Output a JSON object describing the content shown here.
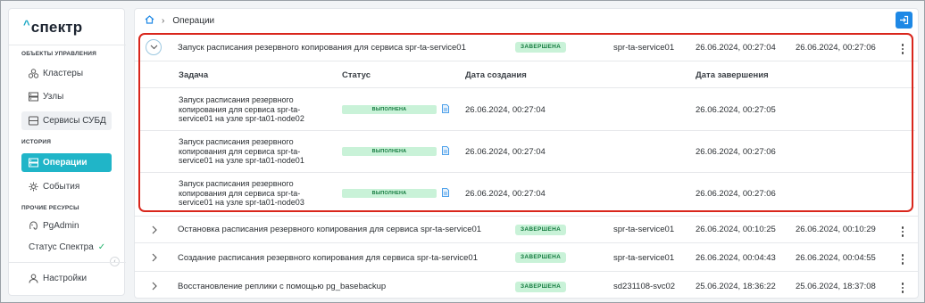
{
  "app": {
    "logo_text": "спектр",
    "accent_color": "#20b5c8",
    "highlight_color": "#d9261c"
  },
  "sidebar": {
    "section_management": "ОБЪЕКТЫ УПРАВЛЕНИЯ",
    "section_history": "ИСТОРИЯ",
    "section_other": "ПРОЧИЕ РЕСУРСЫ",
    "items": {
      "clusters": {
        "label": "Кластеры",
        "icon": "clusters-icon"
      },
      "nodes": {
        "label": "Узлы",
        "icon": "nodes-icon"
      },
      "dbms_services": {
        "label": "Сервисы СУБД",
        "icon": "database-icon"
      },
      "operations": {
        "label": "Операции",
        "icon": "operations-icon"
      },
      "events": {
        "label": "События",
        "icon": "events-icon"
      },
      "pgadmin": {
        "label": "PgAdmin",
        "icon": "pgadmin-icon"
      },
      "status": {
        "label": "Статус Спектра",
        "icon": "check-icon"
      },
      "settings": {
        "label": "Настройки",
        "icon": "user-icon"
      }
    }
  },
  "breadcrumb": {
    "home_icon": "home-icon",
    "current": "Операции"
  },
  "operations": [
    {
      "title": "Запуск расписания резервного копирования для сервиса spr-ta-service01",
      "status": "ЗАВЕРШЕНА",
      "service": "spr-ta-service01",
      "created": "26.06.2024, 00:27:04",
      "finished": "26.06.2024, 00:27:06"
    },
    {
      "title": "Остановка расписания резервного копирования для сервиса spr-ta-service01",
      "status": "ЗАВЕРШЕНА",
      "service": "spr-ta-service01",
      "created": "26.06.2024, 00:10:25",
      "finished": "26.06.2024, 00:10:29"
    },
    {
      "title": "Создание расписания резервного копирования для сервиса spr-ta-service01",
      "status": "ЗАВЕРШЕНА",
      "service": "spr-ta-service01",
      "created": "26.06.2024, 00:04:43",
      "finished": "26.06.2024, 00:04:55"
    },
    {
      "title": "Восстановление реплики с помощью pg_basebackup",
      "status": "ЗАВЕРШЕНА",
      "service": "sd231108-svc02",
      "created": "25.06.2024, 18:36:22",
      "finished": "25.06.2024, 18:37:08"
    }
  ],
  "subtable": {
    "headers": {
      "task": "Задача",
      "status": "Статус",
      "created": "Дата создания",
      "finished": "Дата завершения"
    },
    "tasks": [
      {
        "name": "Запуск расписания резервного копирования для сервиса spr-ta-service01 на узле spr-ta01-node02",
        "status": "ВЫПОЛНЕНА",
        "created": "26.06.2024, 00:27:04",
        "finished": "26.06.2024, 00:27:05"
      },
      {
        "name": "Запуск расписания резервного копирования для сервиса spr-ta-service01 на узле spr-ta01-node01",
        "status": "ВЫПОЛНЕНА",
        "created": "26.06.2024, 00:27:04",
        "finished": "26.06.2024, 00:27:06"
      },
      {
        "name": "Запуск расписания резервного копирования для сервиса spr-ta-service01 на узле spr-ta01-node03",
        "status": "ВЫПОЛНЕНА",
        "created": "26.06.2024, 00:27:04",
        "finished": "26.06.2024, 00:27:06"
      }
    ]
  }
}
